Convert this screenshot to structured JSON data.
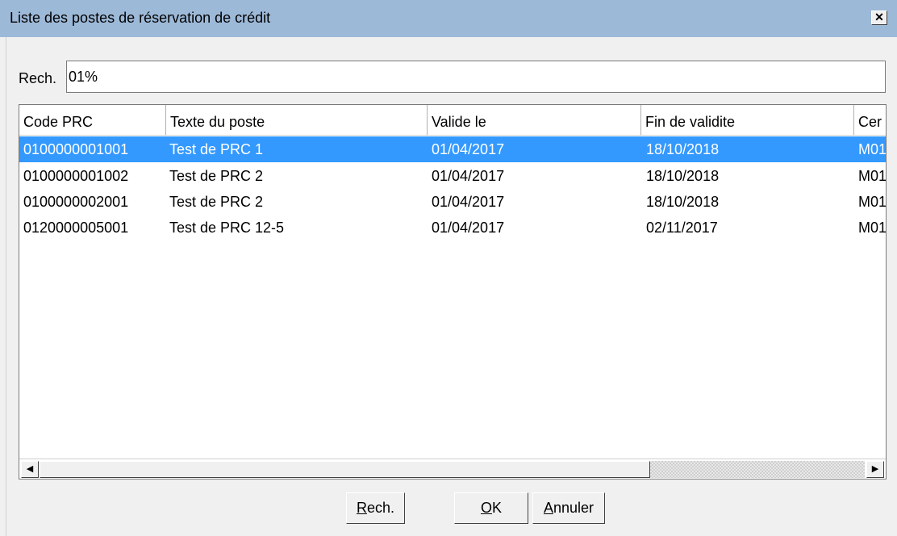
{
  "window": {
    "title": "Liste des postes de réservation de crédit",
    "close_symbol": "✕"
  },
  "search": {
    "label": "Rech.",
    "value": "01%"
  },
  "table": {
    "columns": [
      "Code PRC",
      "Texte du poste",
      "Valide le",
      "Fin de validite",
      "Cer"
    ],
    "rows": [
      {
        "code": "0100000001001",
        "texte": "Test de PRC 1",
        "valide": "01/04/2017",
        "fin": "18/10/2018",
        "cer": "M01",
        "selected": true
      },
      {
        "code": "0100000001002",
        "texte": "Test de PRC 2",
        "valide": "01/04/2017",
        "fin": "18/10/2018",
        "cer": "M01",
        "selected": false
      },
      {
        "code": "0100000002001",
        "texte": "Test de PRC 2",
        "valide": "01/04/2017",
        "fin": "18/10/2018",
        "cer": "M01",
        "selected": false
      },
      {
        "code": "0120000005001",
        "texte": "Test de PRC 12-5",
        "valide": "01/04/2017",
        "fin": "02/11/2017",
        "cer": "M01",
        "selected": false
      }
    ]
  },
  "scrollbar": {
    "left_arrow": "◀",
    "right_arrow": "▶"
  },
  "buttons": {
    "rech": {
      "mnemonic": "R",
      "rest": "ech."
    },
    "ok": {
      "mnemonic": "O",
      "rest": "K"
    },
    "annuler": {
      "mnemonic": "A",
      "rest": "nnuler"
    }
  },
  "colors": {
    "titlebar": "#9db9d8",
    "selection": "#3399ff"
  }
}
